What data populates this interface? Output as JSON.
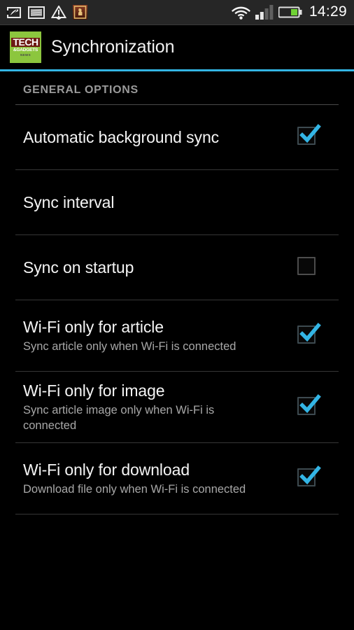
{
  "status_bar": {
    "left_icons": [
      {
        "name": "feather-note-icon",
        "glyph": "feather"
      },
      {
        "name": "screenshot-icon",
        "glyph": "screenshot"
      },
      {
        "name": "warning-triangle-icon",
        "glyph": "warning"
      },
      {
        "name": "chess-app-icon",
        "glyph": "chess"
      }
    ],
    "right_icons": [
      {
        "name": "wifi-icon",
        "glyph": "wifi"
      },
      {
        "name": "cellular-signal-icon",
        "glyph": "signal"
      },
      {
        "name": "battery-icon",
        "glyph": "battery"
      }
    ],
    "clock": "14:29",
    "background_color": "#262626"
  },
  "action_bar": {
    "logo": {
      "name": "tech-gadgets-news-logo",
      "line1": "TECH",
      "line2": "&GADGETS",
      "line3": "NEWS",
      "background_color": "#8cc63e",
      "banner_color": "#6d1a14"
    },
    "title": "Synchronization",
    "accent_color": "#33b5e5"
  },
  "settings": {
    "section_header": "GENERAL OPTIONS",
    "rows": [
      {
        "name": "automatic-background-sync",
        "title": "Automatic background sync",
        "summary": "",
        "control": "checkbox",
        "checked": true
      },
      {
        "name": "sync-interval",
        "title": "Sync interval",
        "summary": "",
        "control": "none",
        "checked": false
      },
      {
        "name": "sync-on-startup",
        "title": "Sync on startup",
        "summary": "",
        "control": "checkbox",
        "checked": false
      },
      {
        "name": "wifi-only-for-article",
        "title": "Wi-Fi only for article",
        "summary": "Sync article only when Wi-Fi is connected",
        "control": "checkbox",
        "checked": true
      },
      {
        "name": "wifi-only-for-image",
        "title": "Wi-Fi only for image",
        "summary": "Sync article image only when Wi-Fi is connected",
        "control": "checkbox",
        "checked": true
      },
      {
        "name": "wifi-only-for-download",
        "title": "Wi-Fi only for download",
        "summary": "Download file only when Wi-Fi is connected",
        "control": "checkbox",
        "checked": true
      }
    ],
    "checkbox_checked_color": "#33b5e5",
    "checkbox_unchecked_color": "#4c4c4c",
    "divider_color": "#4a4a4a",
    "background_color": "#000000"
  }
}
